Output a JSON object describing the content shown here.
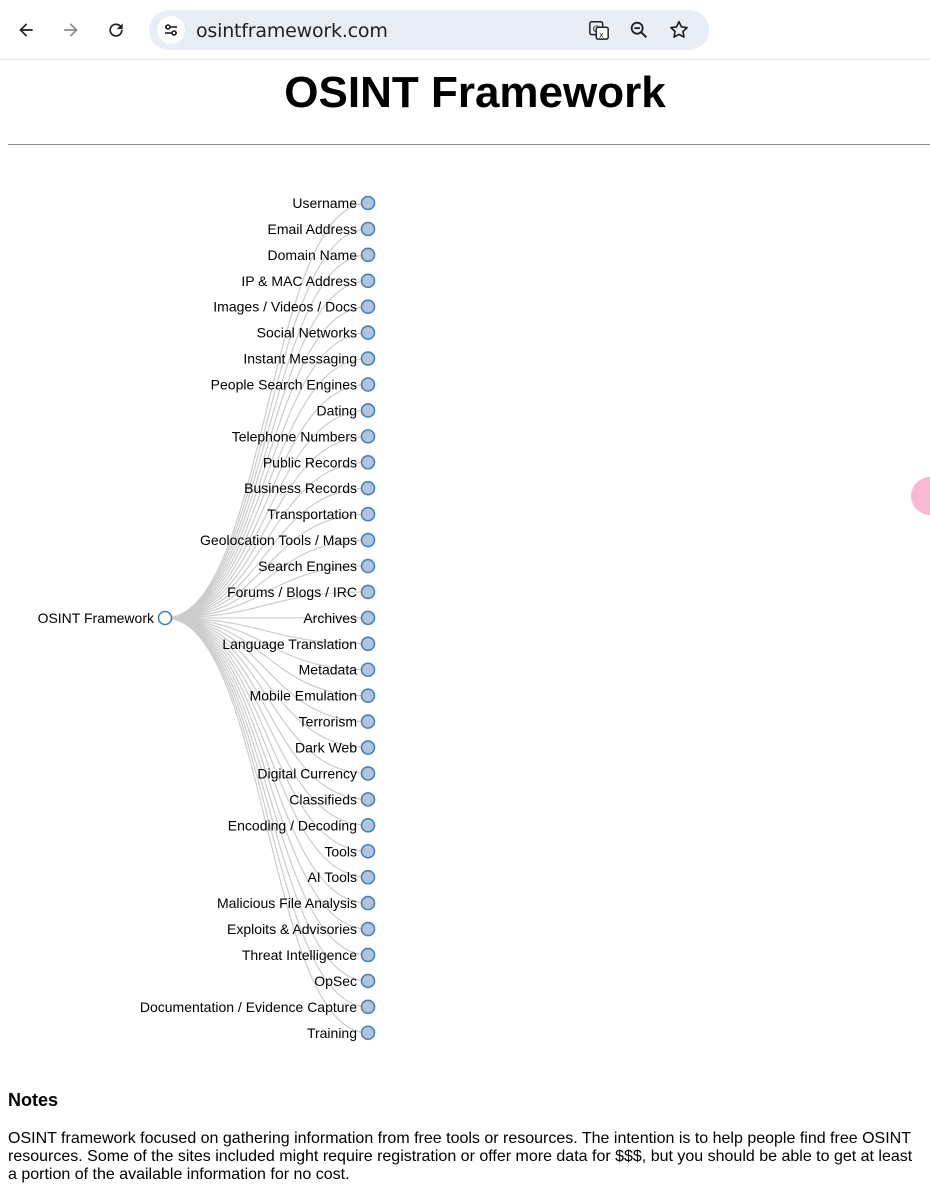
{
  "browser": {
    "url": "osintframework.com",
    "icons": {
      "back": "back-arrow-icon",
      "forward": "forward-arrow-icon",
      "reload": "reload-icon",
      "site_info": "site-info-icon",
      "translate": "translate-icon",
      "zoom": "zoom-out-icon",
      "bookmark": "star-icon"
    }
  },
  "page": {
    "title": "OSINT Framework"
  },
  "tree": {
    "root": "OSINT Framework",
    "children": [
      "Username",
      "Email Address",
      "Domain Name",
      "IP & MAC Address",
      "Images / Videos / Docs",
      "Social Networks",
      "Instant Messaging",
      "People Search Engines",
      "Dating",
      "Telephone Numbers",
      "Public Records",
      "Business Records",
      "Transportation",
      "Geolocation Tools / Maps",
      "Search Engines",
      "Forums / Blogs / IRC",
      "Archives",
      "Language Translation",
      "Metadata",
      "Mobile Emulation",
      "Terrorism",
      "Dark Web",
      "Digital Currency",
      "Classifieds",
      "Encoding / Decoding",
      "Tools",
      "AI Tools",
      "Malicious File Analysis",
      "Exploits & Advisories",
      "Threat Intelligence",
      "OpSec",
      "Documentation / Evidence Capture",
      "Training"
    ],
    "colors": {
      "node_fill": "#b0c4de",
      "node_stroke": "#4682b4",
      "link": "#cccccc"
    }
  },
  "notes": {
    "title": "Notes",
    "text": "OSINT framework focused on gathering information from free tools or resources. The intention is to help people find free OSINT resources. Some of the sites included might require registration or offer more data for $$$, but you should be able to get at least a portion of the available information for no cost."
  }
}
